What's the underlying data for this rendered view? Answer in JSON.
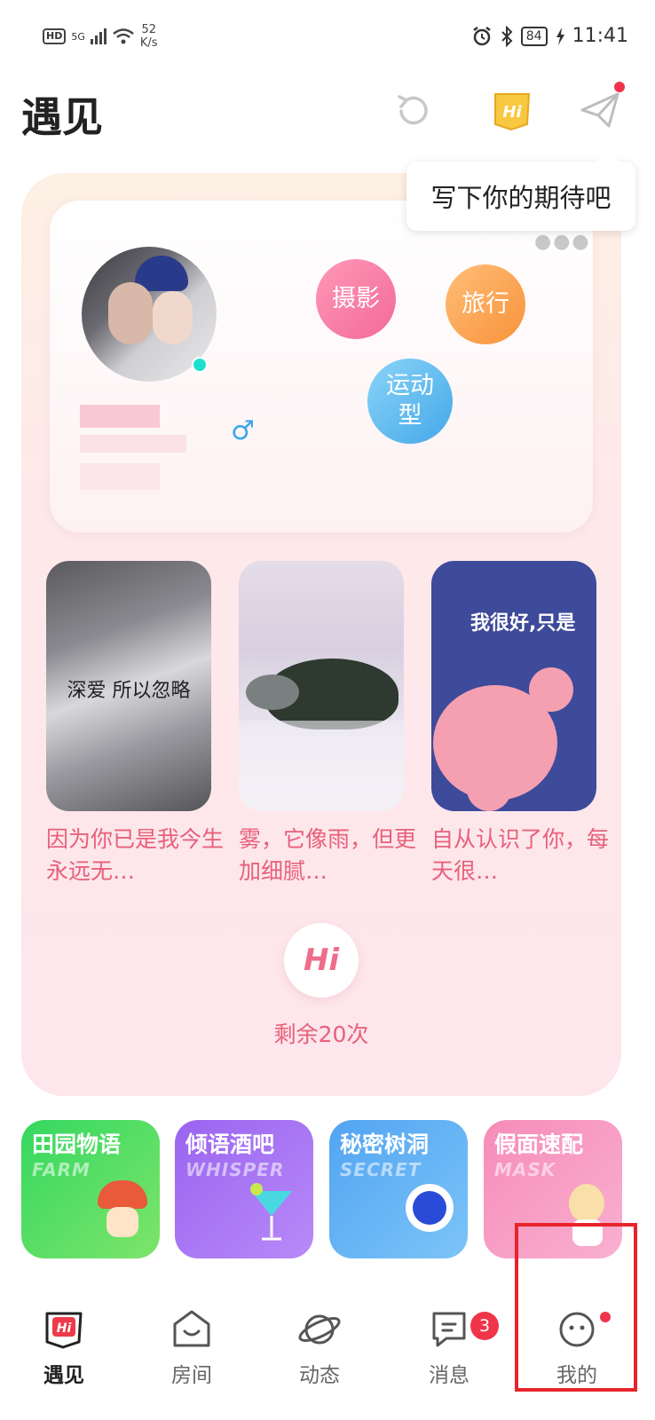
{
  "status_bar": {
    "hd": "HD",
    "signal": "5G",
    "speed_value": "52",
    "speed_unit": "K/s",
    "battery": "84",
    "time": "11:41"
  },
  "header": {
    "title": "遇见",
    "tooltip": "写下你的期待吧"
  },
  "profile": {
    "tags": [
      "摄影",
      "旅行",
      "运动型"
    ],
    "gender_symbol": "♂"
  },
  "moments": [
    {
      "image_text": "深爱 所以忽略",
      "caption": "因为你已是我今生永远无…"
    },
    {
      "image_text": "",
      "caption": "雾，它像雨，但更加细腻…"
    },
    {
      "image_text": "我很好,只是",
      "caption": "自从认识了你，每天很…"
    }
  ],
  "hi_button": {
    "label": "Hi",
    "remaining": "剩余20次"
  },
  "features": [
    {
      "title": "田园物语",
      "subtitle": "FARM",
      "color": "#3ed66a"
    },
    {
      "title": "倾语酒吧",
      "subtitle": "WHISPER",
      "color": "#a070f0"
    },
    {
      "title": "秘密树洞",
      "subtitle": "SECRET",
      "color": "#5aaaf2"
    },
    {
      "title": "假面速配",
      "subtitle": "MASK",
      "color": "#f48cbc"
    }
  ],
  "bottom_nav": {
    "items": [
      {
        "label": "遇见",
        "active": true
      },
      {
        "label": "房间"
      },
      {
        "label": "动态"
      },
      {
        "label": "消息",
        "badge": "3"
      },
      {
        "label": "我的"
      }
    ]
  },
  "colors": {
    "accent": "#e8607a",
    "badge": "#f0344a",
    "online": "#1ee0d0"
  }
}
